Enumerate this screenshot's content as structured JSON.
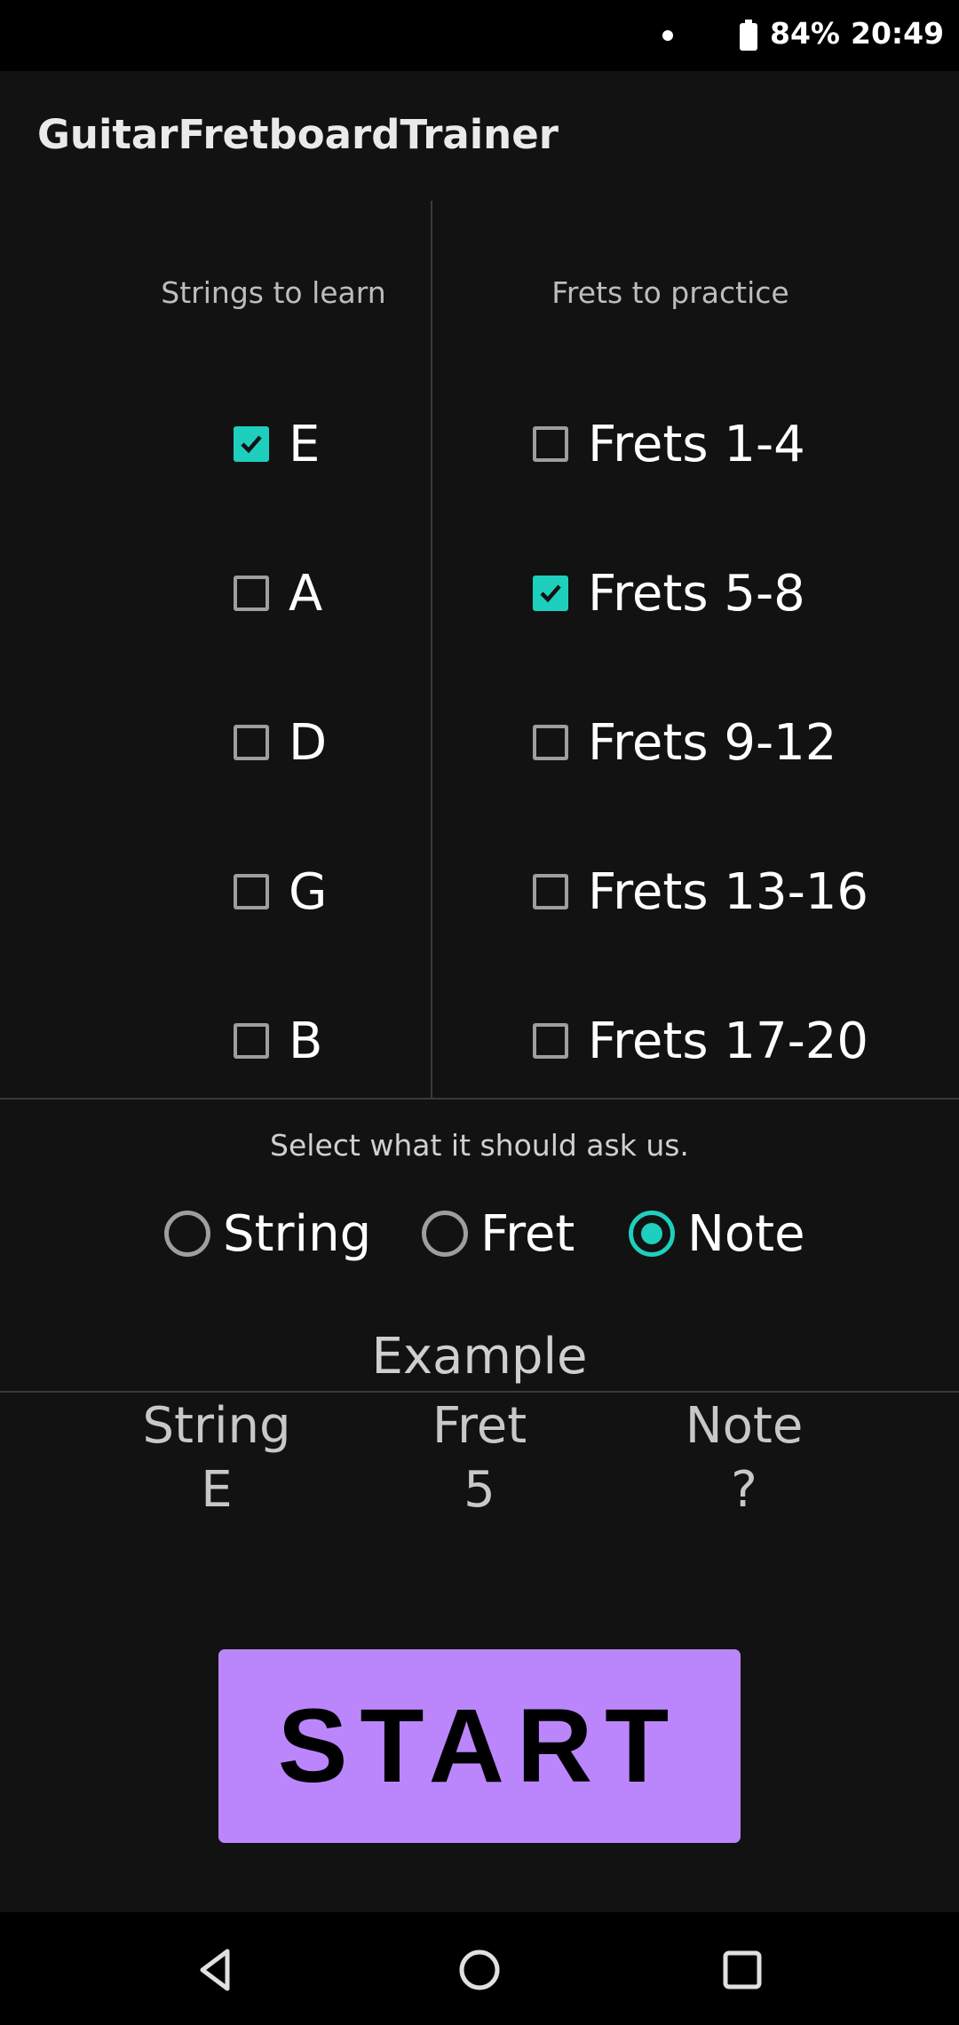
{
  "status_bar": {
    "battery": "84%",
    "time": "20:49",
    "icons": [
      "notification-dot-icon",
      "battery-icon"
    ]
  },
  "app": {
    "title": "GuitarFretboardTrainer"
  },
  "strings": {
    "header": "Strings to learn",
    "items": [
      {
        "label": "E",
        "checked": true
      },
      {
        "label": "A",
        "checked": false
      },
      {
        "label": "D",
        "checked": false
      },
      {
        "label": "G",
        "checked": false
      },
      {
        "label": "B",
        "checked": false
      }
    ]
  },
  "frets": {
    "header": "Frets to practice",
    "items": [
      {
        "label": "Frets 1-4",
        "checked": false
      },
      {
        "label": "Frets 5-8",
        "checked": true
      },
      {
        "label": "Frets 9-12",
        "checked": false
      },
      {
        "label": "Frets 13-16",
        "checked": false
      },
      {
        "label": "Frets 17-20",
        "checked": false
      }
    ]
  },
  "ask": {
    "label": "Select what it should ask us.",
    "options": [
      {
        "label": "String",
        "selected": false
      },
      {
        "label": "Fret",
        "selected": false
      },
      {
        "label": "Note",
        "selected": true
      }
    ]
  },
  "example": {
    "title": "Example",
    "columns": [
      {
        "header": "String",
        "value": "E"
      },
      {
        "header": "Fret",
        "value": "5"
      },
      {
        "header": "Note",
        "value": "?"
      }
    ]
  },
  "start_button": {
    "label": "START"
  },
  "nav_bar": {
    "icons": [
      "back-icon",
      "home-icon",
      "recents-icon"
    ]
  },
  "colors": {
    "accent": "#1ecfbe",
    "button": "#bb86fc",
    "background": "#121212"
  }
}
